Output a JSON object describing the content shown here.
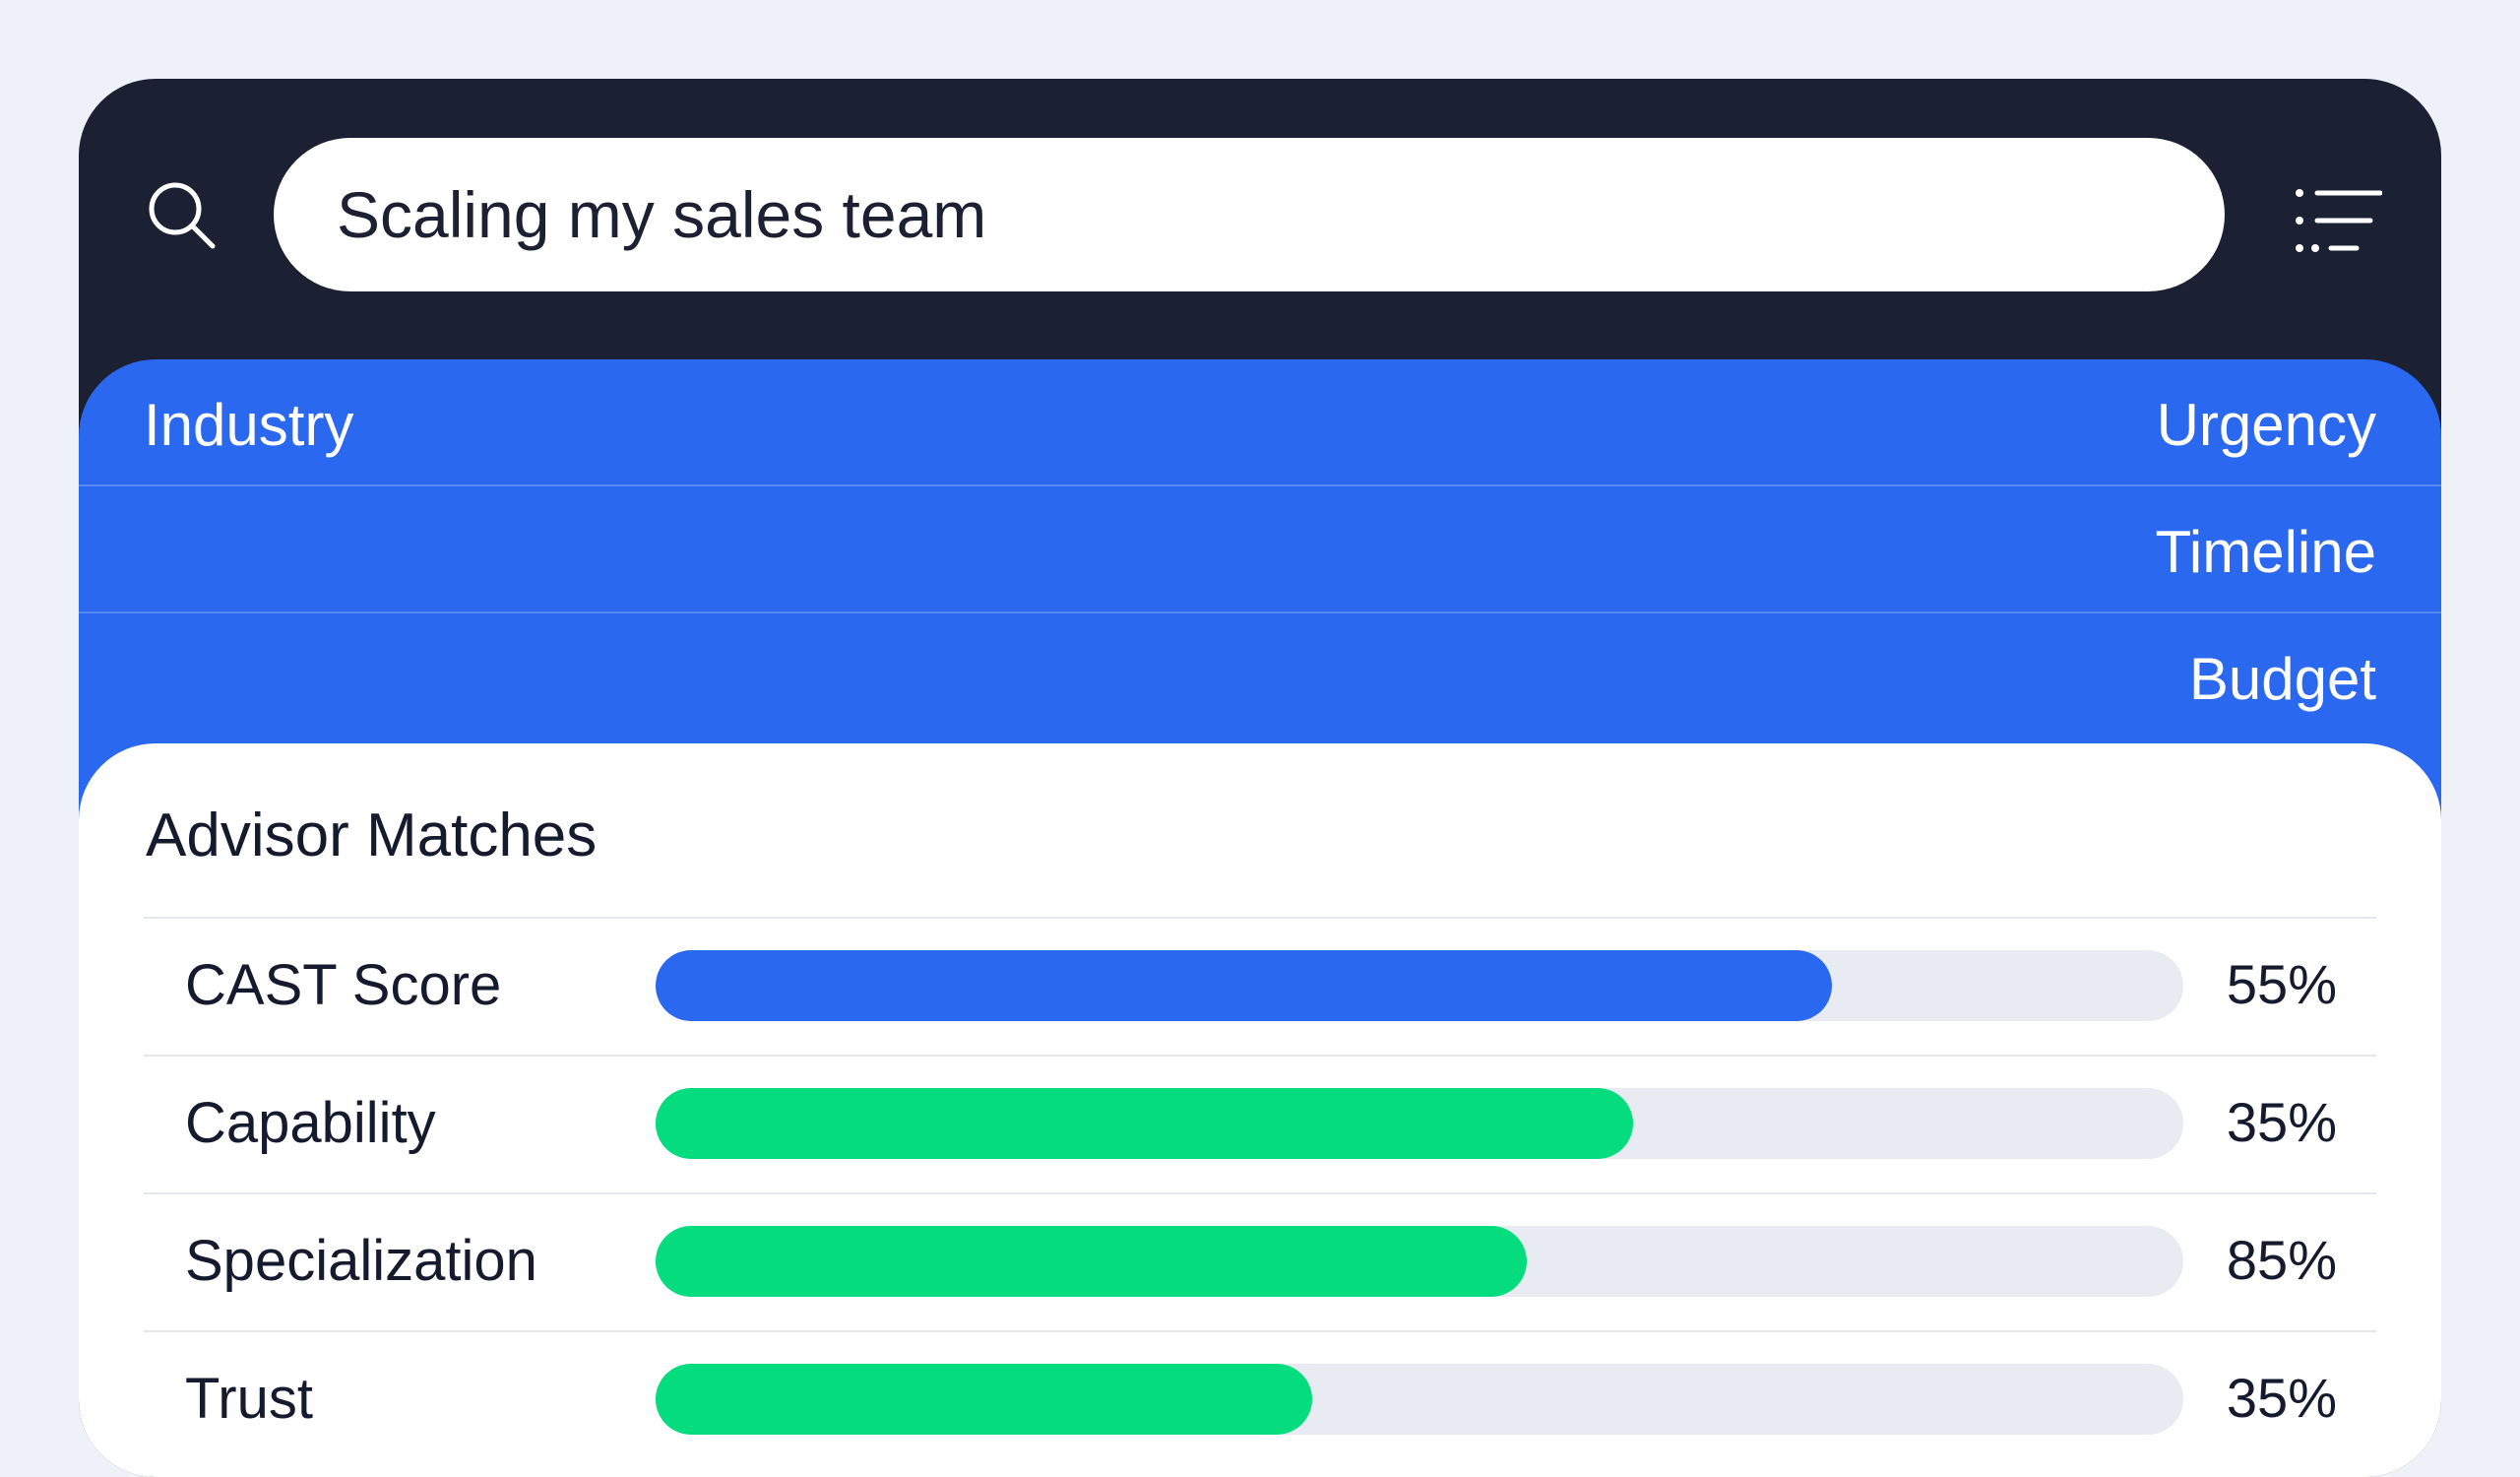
{
  "search": {
    "value": "Scaling my sales team"
  },
  "filters": {
    "row1_left": "Industry",
    "row1_right": "Urgency",
    "row2_right": "Timeline",
    "row3_right": "Budget"
  },
  "panel": {
    "title": "Advisor Matches"
  },
  "metrics": [
    {
      "label": "CAST Score",
      "pct": "55%",
      "fill": 0.77,
      "color": "#2a68f0"
    },
    {
      "label": "Capability",
      "pct": "35%",
      "fill": 0.64,
      "color": "#05dc7e"
    },
    {
      "label": "Specialization",
      "pct": "85%",
      "fill": 0.57,
      "color": "#05dc7e"
    },
    {
      "label": "Trust",
      "pct": "35%",
      "fill": 0.43,
      "color": "#05dc7e"
    }
  ],
  "icons": {
    "search": "search-icon",
    "menu": "filter-menu-icon"
  }
}
